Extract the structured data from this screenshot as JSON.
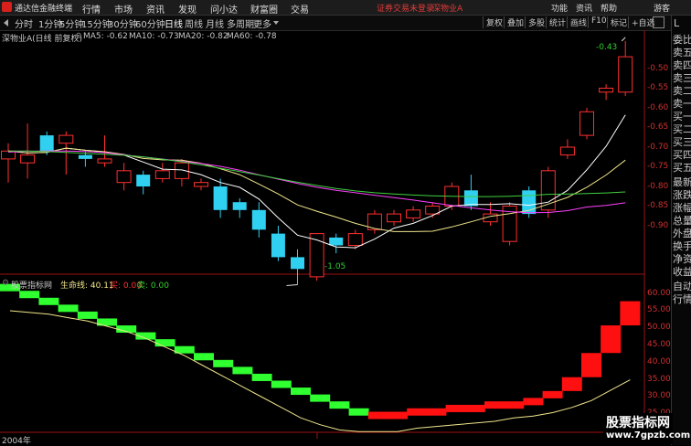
{
  "app": {
    "name": "通达信金融终端"
  },
  "menu": {
    "items": [
      "行情",
      "市场",
      "资讯",
      "发现",
      "问小达",
      "财富圈",
      "交易"
    ]
  },
  "notice": "证券交易未登录",
  "stock_name_top": "深物业A",
  "top_right": {
    "items": [
      "功能",
      "资讯",
      "帮助"
    ],
    "user": "游客"
  },
  "periods": [
    "分时",
    "1分钟",
    "5分钟",
    "15分钟",
    "30分钟",
    "60分钟",
    "日线",
    "周线",
    "月线",
    "多周期",
    "更多"
  ],
  "active_period": "日线",
  "toolbar": [
    "复权",
    "叠加",
    "多股",
    "统计",
    "画线",
    "F10",
    "标记",
    "+自选"
  ],
  "chart": {
    "title": "深物业A(日线 前复权)",
    "ma": [
      {
        "label": "MA5: -0.62",
        "color": "#ffffff"
      },
      {
        "label": "MA10: -0.73",
        "color": "#f0e68c"
      },
      {
        "label": "MA20: -0.82",
        "color": "#ff40ff"
      },
      {
        "label": "MA60: -0.78",
        "color": "#40d040"
      }
    ],
    "high_label": "-0.43",
    "low_label": "-1.05",
    "y_ticks": [
      "-0.50",
      "-0.55",
      "-0.60",
      "-0.65",
      "-0.70",
      "-0.75",
      "-0.80",
      "-0.85",
      "-0.90"
    ]
  },
  "candles": [
    {
      "o": -0.73,
      "c": -0.71,
      "h": -0.69,
      "l": -0.79
    },
    {
      "o": -0.74,
      "c": -0.72,
      "h": -0.64,
      "l": -0.78
    },
    {
      "o": -0.67,
      "c": -0.71,
      "h": -0.66,
      "l": -0.72
    },
    {
      "o": -0.69,
      "c": -0.67,
      "h": -0.66,
      "l": -0.77
    },
    {
      "o": -0.72,
      "c": -0.73,
      "h": -0.71,
      "l": -0.75
    },
    {
      "o": -0.74,
      "c": -0.73,
      "h": -0.67,
      "l": -0.75
    },
    {
      "o": -0.79,
      "c": -0.76,
      "h": -0.74,
      "l": -0.81
    },
    {
      "o": -0.77,
      "c": -0.8,
      "h": -0.76,
      "l": -0.82
    },
    {
      "o": -0.78,
      "c": -0.76,
      "h": -0.74,
      "l": -0.79
    },
    {
      "o": -0.78,
      "c": -0.74,
      "h": -0.73,
      "l": -0.8
    },
    {
      "o": -0.8,
      "c": -0.79,
      "h": -0.78,
      "l": -0.81
    },
    {
      "o": -0.8,
      "c": -0.86,
      "h": -0.78,
      "l": -0.88
    },
    {
      "o": -0.84,
      "c": -0.86,
      "h": -0.83,
      "l": -0.88
    },
    {
      "o": -0.86,
      "c": -0.91,
      "h": -0.84,
      "l": -0.93
    },
    {
      "o": -0.92,
      "c": -0.98,
      "h": -0.9,
      "l": -0.99
    },
    {
      "o": -0.98,
      "c": -1.01,
      "h": -0.96,
      "l": -1.05
    },
    {
      "o": -1.03,
      "c": -0.92,
      "h": -0.92,
      "l": -1.04
    },
    {
      "o": -0.93,
      "c": -0.95,
      "h": -0.92,
      "l": -0.97
    },
    {
      "o": -0.95,
      "c": -0.92,
      "h": -0.91,
      "l": -0.96
    },
    {
      "o": -0.91,
      "c": -0.87,
      "h": -0.86,
      "l": -0.92
    },
    {
      "o": -0.89,
      "c": -0.87,
      "h": -0.86,
      "l": -0.9
    },
    {
      "o": -0.88,
      "c": -0.86,
      "h": -0.85,
      "l": -0.89
    },
    {
      "o": -0.87,
      "c": -0.85,
      "h": -0.84,
      "l": -0.88
    },
    {
      "o": -0.85,
      "c": -0.8,
      "h": -0.79,
      "l": -0.86
    },
    {
      "o": -0.81,
      "c": -0.85,
      "h": -0.77,
      "l": -0.86
    },
    {
      "o": -0.89,
      "c": -0.87,
      "h": -0.84,
      "l": -0.9
    },
    {
      "o": -0.94,
      "c": -0.85,
      "h": -0.84,
      "l": -0.95
    },
    {
      "o": -0.81,
      "c": -0.87,
      "h": -0.8,
      "l": -0.88
    },
    {
      "o": -0.86,
      "c": -0.76,
      "h": -0.75,
      "l": -0.88
    },
    {
      "o": -0.72,
      "c": -0.7,
      "h": -0.68,
      "l": -0.73
    },
    {
      "o": -0.67,
      "c": -0.61,
      "h": -0.6,
      "l": -0.68
    },
    {
      "o": -0.56,
      "c": -0.55,
      "h": -0.54,
      "l": -0.58
    },
    {
      "o": -0.56,
      "c": -0.47,
      "h": -0.43,
      "l": -0.57
    }
  ],
  "indicator": {
    "title": "股票指标网",
    "lifeline": "生命线: 40.11",
    "buy": "买: 0.00",
    "sell": "卖: 0.00",
    "y_ticks": [
      "60.00",
      "55.00",
      "50.00",
      "45.00",
      "40.00",
      "35.00",
      "30.00",
      "25.00"
    ],
    "bars": [
      61,
      59,
      57,
      55,
      53,
      51,
      49,
      47,
      45,
      43,
      41,
      39,
      37,
      35,
      33,
      31,
      29,
      27,
      26,
      26,
      26,
      27,
      27,
      28,
      28,
      29,
      29,
      30,
      32,
      36,
      43,
      51,
      58
    ],
    "lifeline_vals": [
      60,
      59.5,
      59,
      58,
      57,
      55.5,
      54,
      52,
      49.5,
      47,
      44,
      41,
      38,
      35,
      32,
      29,
      27,
      25.5,
      25,
      25,
      25,
      26,
      26.5,
      27,
      27.5,
      28,
      29,
      29.5,
      30.5,
      32,
      34,
      37,
      40
    ]
  },
  "bottom": {
    "year": "2004年"
  },
  "right_panel": [
    "委比",
    "卖五",
    "卖四",
    "卖三",
    "卖二",
    "卖一",
    "买一",
    "买二",
    "买三",
    "买四",
    "买五",
    "最新",
    "涨跌",
    "涨幅",
    "总量",
    "外盘",
    "换手",
    "净资",
    "收益",
    "自动",
    "行情"
  ],
  "watermark": {
    "line1": "股票指标网",
    "line2": "www.7gpzb.com"
  },
  "colors": {
    "up": "#ff3030",
    "down": "#30d0f0",
    "ind_up": "#ff1010",
    "ind_down": "#30ff30",
    "lifeline": "#f0e68c"
  }
}
